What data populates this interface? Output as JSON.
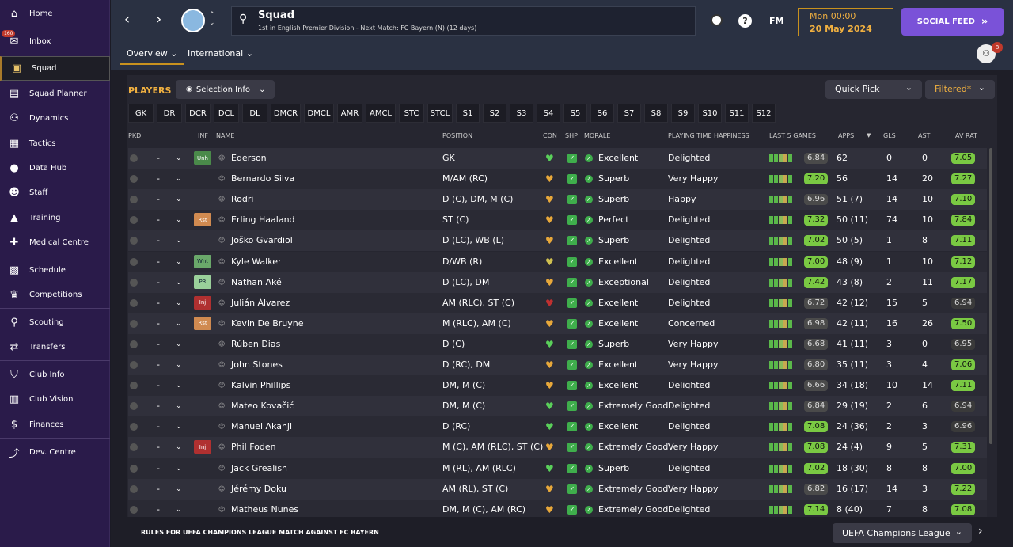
{
  "nav": {
    "home": "Home",
    "inbox": "Inbox",
    "inbox_badge": "160",
    "squad": "Squad",
    "squad_planner": "Squad Planner",
    "dynamics": "Dynamics",
    "tactics": "Tactics",
    "data_hub": "Data Hub",
    "staff": "Staff",
    "training": "Training",
    "medical": "Medical Centre",
    "schedule": "Schedule",
    "competitions": "Competitions",
    "scouting": "Scouting",
    "transfers": "Transfers",
    "club_info": "Club Info",
    "club_vision": "Club Vision",
    "finances": "Finances",
    "dev_centre": "Dev. Centre"
  },
  "header": {
    "title": "Squad",
    "subtitle": "1st in English Premier Division - Next Match: FC Bayern (N) (12 days)",
    "fm": "FM",
    "time": "Mon 00:00",
    "date": "20 May 2024",
    "social": "SOCIAL FEED",
    "notif_count": "8"
  },
  "tabs": {
    "overview": "Overview",
    "international": "International"
  },
  "players_label": "PLAYERS",
  "selection_info": "Selection Info",
  "quick_pick": "Quick Pick",
  "filtered": "Filtered*",
  "positions": [
    "GK",
    "DR",
    "DCR",
    "DCL",
    "DL",
    "DMCR",
    "DMCL",
    "AMR",
    "AMCL",
    "STC",
    "STCL",
    "S1",
    "S2",
    "S3",
    "S4",
    "S5",
    "S6",
    "S7",
    "S8",
    "S9",
    "S10",
    "S11",
    "S12"
  ],
  "columns": {
    "pkd": "PKD",
    "inf": "INF",
    "name": "NAME",
    "position": "POSITION",
    "con": "CON",
    "shp": "SHP",
    "morale": "MORALE",
    "pth": "PLAYING TIME HAPPINESS",
    "last5": "LAST 5 GAMES",
    "apps": "APPS",
    "gls": "GLS",
    "ast": "AST",
    "avrat": "AV RAT"
  },
  "players": [
    {
      "name": "Ederson",
      "inf": "Unh",
      "pos": "GK",
      "morale": "Excellent",
      "happy": "Delighted",
      "l5": "6.84",
      "apps": "62",
      "gls": "0",
      "ast": "0",
      "av": "7.05"
    },
    {
      "name": "Bernardo Silva",
      "inf": "",
      "pos": "M/AM (RC)",
      "morale": "Superb",
      "happy": "Very Happy",
      "l5": "7.20",
      "apps": "56",
      "gls": "14",
      "ast": "20",
      "av": "7.27"
    },
    {
      "name": "Rodri",
      "inf": "",
      "pos": "D (C), DM, M (C)",
      "morale": "Superb",
      "happy": "Happy",
      "l5": "6.96",
      "apps": "51 (7)",
      "gls": "14",
      "ast": "10",
      "av": "7.10"
    },
    {
      "name": "Erling Haaland",
      "inf": "Rst",
      "pos": "ST (C)",
      "morale": "Perfect",
      "happy": "Delighted",
      "l5": "7.32",
      "apps": "50 (11)",
      "gls": "74",
      "ast": "10",
      "av": "7.84"
    },
    {
      "name": "Joško Gvardiol",
      "inf": "",
      "pos": "D (LC), WB (L)",
      "morale": "Superb",
      "happy": "Delighted",
      "l5": "7.02",
      "apps": "50 (5)",
      "gls": "1",
      "ast": "8",
      "av": "7.11"
    },
    {
      "name": "Kyle Walker",
      "inf": "Wnt",
      "pos": "D/WB (R)",
      "morale": "Excellent",
      "happy": "Delighted",
      "l5": "7.00",
      "apps": "48 (9)",
      "gls": "1",
      "ast": "10",
      "av": "7.12"
    },
    {
      "name": "Nathan Aké",
      "inf": "PR",
      "pos": "D (LC), DM",
      "morale": "Exceptional",
      "happy": "Delighted",
      "l5": "7.42",
      "apps": "43 (8)",
      "gls": "2",
      "ast": "11",
      "av": "7.17"
    },
    {
      "name": "Julián Álvarez",
      "inf": "Inj",
      "pos": "AM (RLC), ST (C)",
      "morale": "Excellent",
      "happy": "Delighted",
      "l5": "6.72",
      "apps": "42 (12)",
      "gls": "15",
      "ast": "5",
      "av": "6.94"
    },
    {
      "name": "Kevin De Bruyne",
      "inf": "Rst",
      "pos": "M (RLC), AM (C)",
      "morale": "Excellent",
      "happy": "Concerned",
      "l5": "6.98",
      "apps": "42 (11)",
      "gls": "16",
      "ast": "26",
      "av": "7.50"
    },
    {
      "name": "Rúben Dias",
      "inf": "",
      "pos": "D (C)",
      "morale": "Superb",
      "happy": "Very Happy",
      "l5": "6.68",
      "apps": "41 (11)",
      "gls": "3",
      "ast": "0",
      "av": "6.95"
    },
    {
      "name": "John Stones",
      "inf": "",
      "pos": "D (RC), DM",
      "morale": "Excellent",
      "happy": "Very Happy",
      "l5": "6.80",
      "apps": "35 (11)",
      "gls": "3",
      "ast": "4",
      "av": "7.06"
    },
    {
      "name": "Kalvin Phillips",
      "inf": "",
      "pos": "DM, M (C)",
      "morale": "Excellent",
      "happy": "Delighted",
      "l5": "6.66",
      "apps": "34 (18)",
      "gls": "10",
      "ast": "14",
      "av": "7.11"
    },
    {
      "name": "Mateo Kovačić",
      "inf": "",
      "pos": "DM, M (C)",
      "morale": "Extremely Good",
      "happy": "Delighted",
      "l5": "6.84",
      "apps": "29 (19)",
      "gls": "2",
      "ast": "6",
      "av": "6.94"
    },
    {
      "name": "Manuel Akanji",
      "inf": "",
      "pos": "D (RC)",
      "morale": "Excellent",
      "happy": "Delighted",
      "l5": "7.08",
      "apps": "24 (36)",
      "gls": "2",
      "ast": "3",
      "av": "6.96"
    },
    {
      "name": "Phil Foden",
      "inf": "Inj",
      "pos": "M (C), AM (RLC), ST (C)",
      "morale": "Extremely Good",
      "happy": "Very Happy",
      "l5": "7.08",
      "apps": "24 (4)",
      "gls": "9",
      "ast": "5",
      "av": "7.31"
    },
    {
      "name": "Jack Grealish",
      "inf": "",
      "pos": "M (RL), AM (RLC)",
      "morale": "Superb",
      "happy": "Delighted",
      "l5": "7.02",
      "apps": "18 (30)",
      "gls": "8",
      "ast": "8",
      "av": "7.00"
    },
    {
      "name": "Jérémy Doku",
      "inf": "",
      "pos": "AM (RL), ST (C)",
      "morale": "Extremely Good",
      "happy": "Very Happy",
      "l5": "6.82",
      "apps": "16 (17)",
      "gls": "14",
      "ast": "3",
      "av": "7.22"
    },
    {
      "name": "Matheus Nunes",
      "inf": "",
      "pos": "DM, M (C), AM (RC)",
      "morale": "Extremely Good",
      "happy": "Delighted",
      "l5": "7.14",
      "apps": "8 (40)",
      "gls": "7",
      "ast": "8",
      "av": "7.08"
    }
  ],
  "pkd_dash": "-",
  "footer": {
    "rules": "RULES FOR UEFA CHAMPIONS LEAGUE MATCH AGAINST FC BAYERN",
    "competition": "UEFA Champions League"
  }
}
